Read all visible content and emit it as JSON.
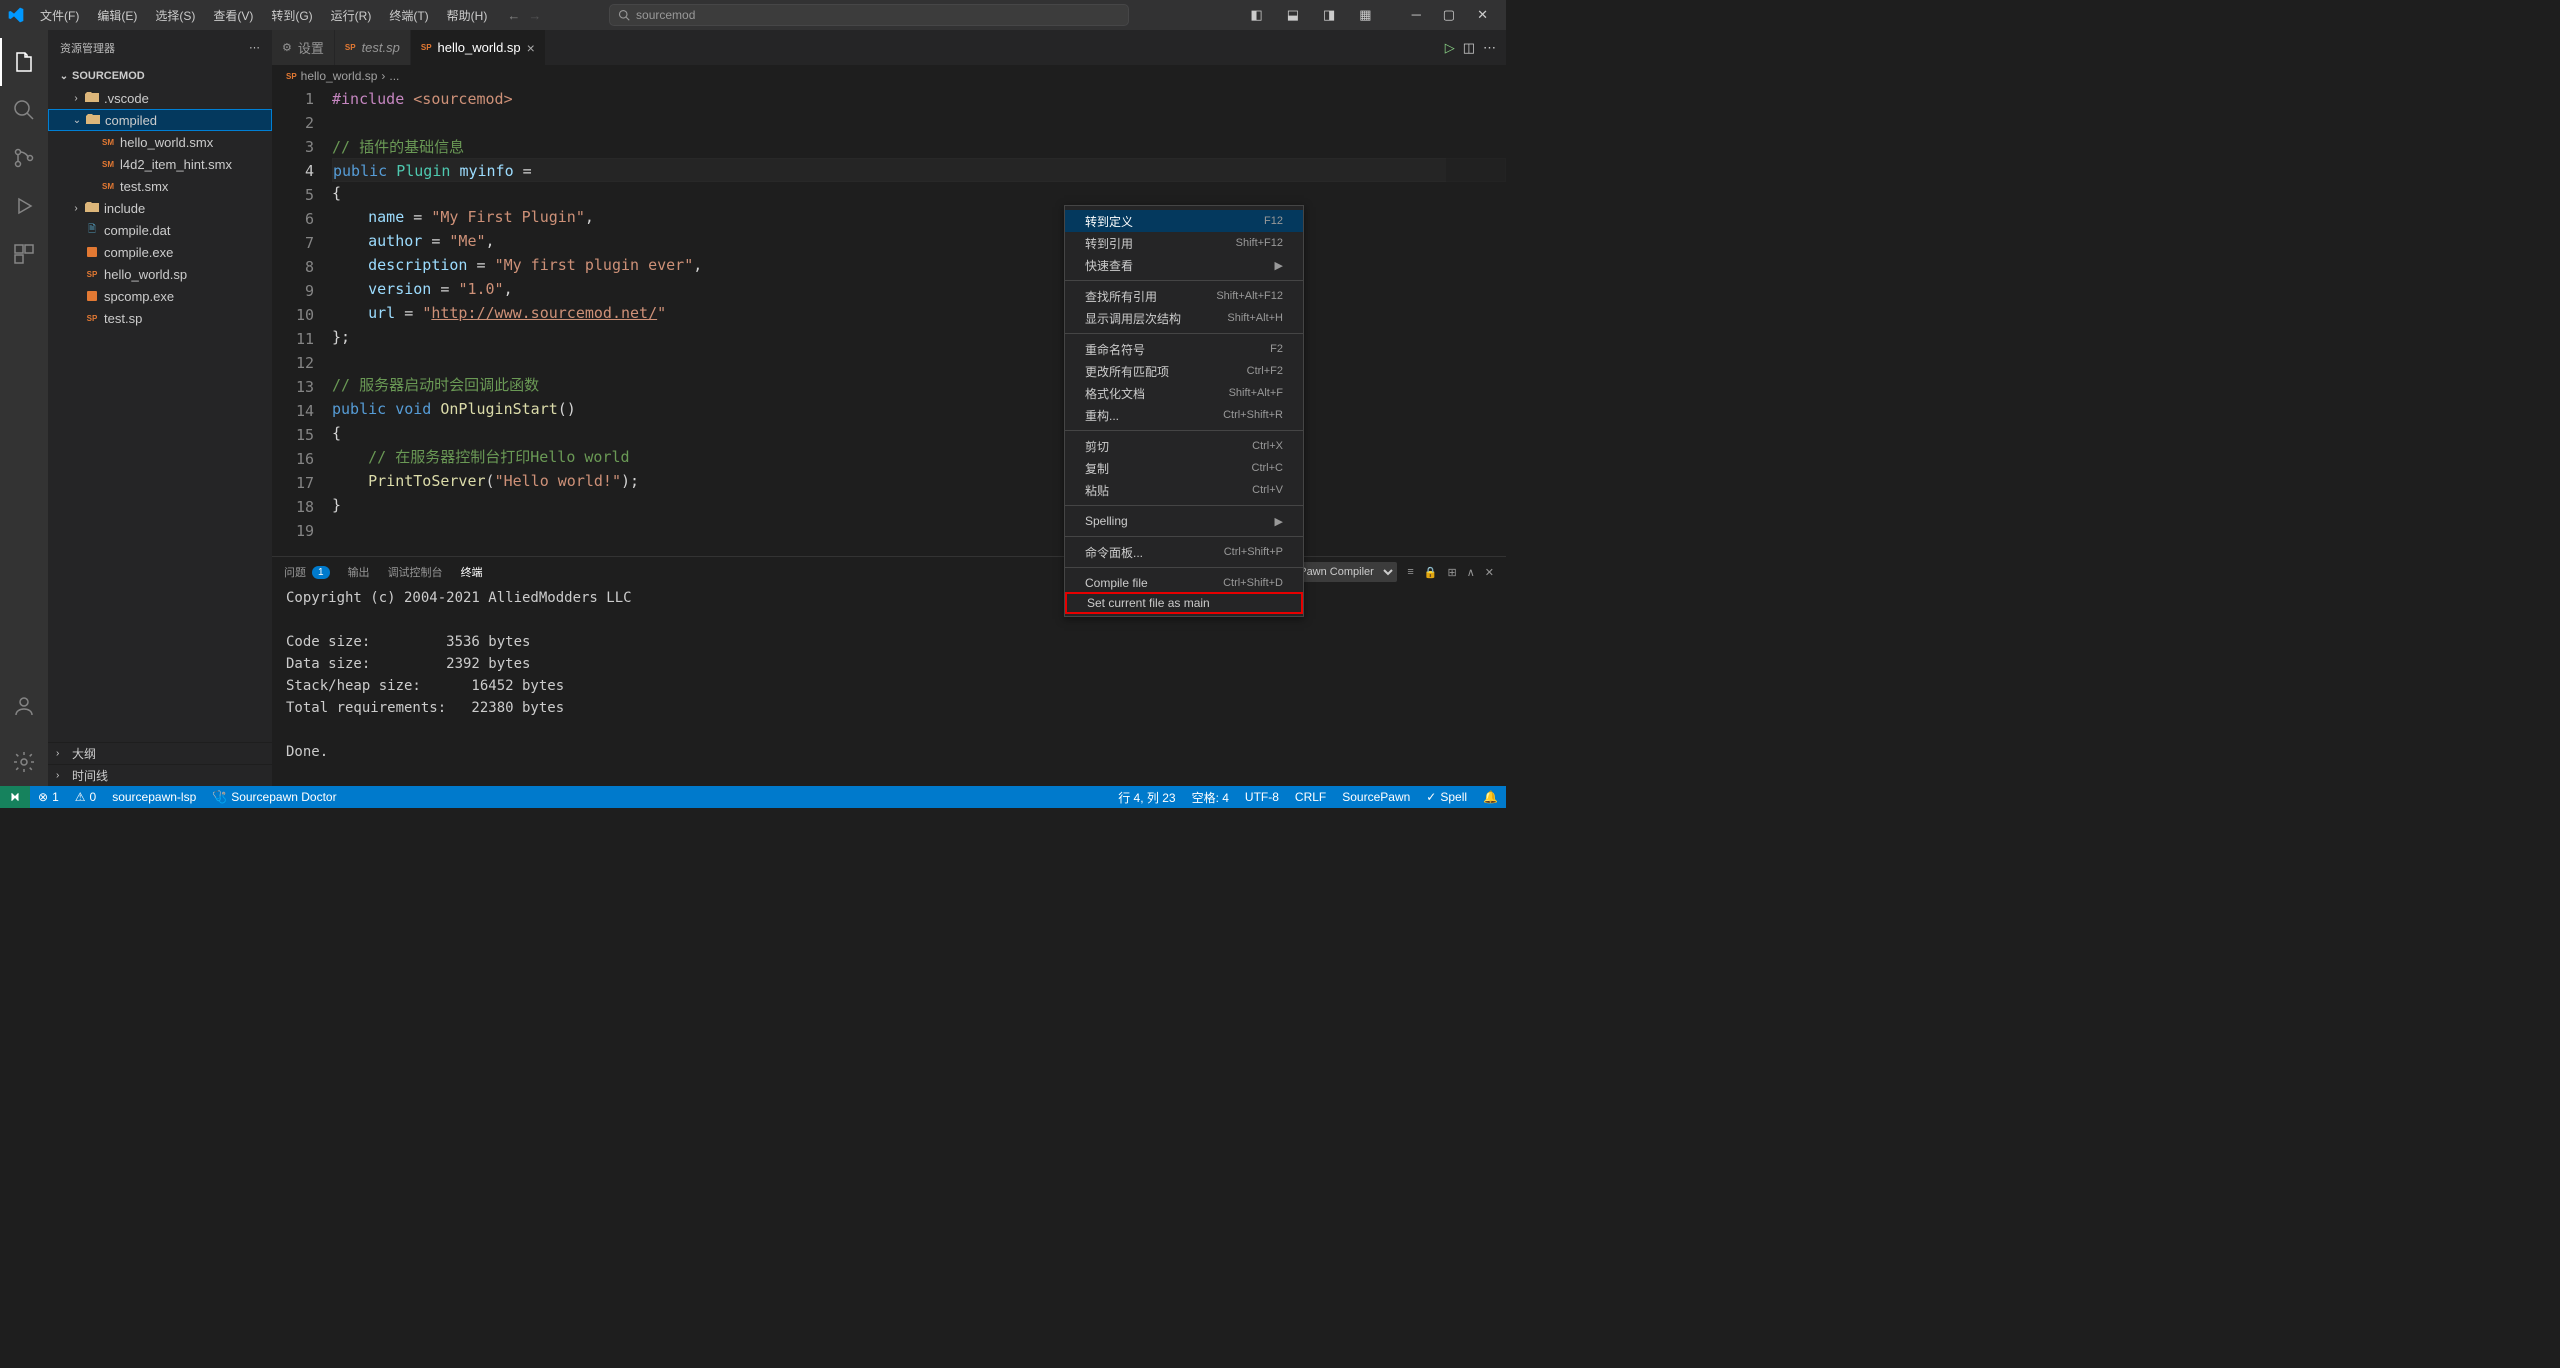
{
  "menubar": [
    "文件(F)",
    "编辑(E)",
    "选择(S)",
    "查看(V)",
    "转到(G)",
    "运行(R)",
    "终端(T)",
    "帮助(H)"
  ],
  "search_placeholder": "sourcemod",
  "sidebar": {
    "title": "资源管理器",
    "root": "SOURCEMOD",
    "tree": [
      {
        "t": "folder",
        "name": ".vscode",
        "ind": 1,
        "open": false
      },
      {
        "t": "folder",
        "name": "compiled",
        "ind": 1,
        "open": true,
        "selected": true
      },
      {
        "t": "file",
        "name": "hello_world.smx",
        "ind": 2,
        "icon": "sm"
      },
      {
        "t": "file",
        "name": "l4d2_item_hint.smx",
        "ind": 2,
        "icon": "sm"
      },
      {
        "t": "file",
        "name": "test.smx",
        "ind": 2,
        "icon": "sm"
      },
      {
        "t": "folder",
        "name": "include",
        "ind": 1,
        "open": false
      },
      {
        "t": "file",
        "name": "compile.dat",
        "ind": 1,
        "icon": "file-i"
      },
      {
        "t": "file",
        "name": "compile.exe",
        "ind": 1,
        "icon": "exe-i"
      },
      {
        "t": "file",
        "name": "hello_world.sp",
        "ind": 1,
        "icon": "sp"
      },
      {
        "t": "file",
        "name": "spcomp.exe",
        "ind": 1,
        "icon": "exe-i"
      },
      {
        "t": "file",
        "name": "test.sp",
        "ind": 1,
        "icon": "sp"
      }
    ],
    "footer": [
      "大纲",
      "时间线"
    ]
  },
  "tabs": [
    {
      "label": "设置",
      "icon": "gear",
      "active": false
    },
    {
      "label": "test.sp",
      "icon": "sp",
      "active": false,
      "italic": true
    },
    {
      "label": "hello_world.sp",
      "icon": "sp",
      "active": true,
      "close": true
    }
  ],
  "breadcrumb": [
    "hello_world.sp",
    "..."
  ],
  "code": {
    "lines": [
      [
        {
          "c": "tk-pre",
          "t": "#include"
        },
        {
          "c": "tk-p",
          "t": " "
        },
        {
          "c": "tk-inc",
          "t": "<sourcemod>"
        }
      ],
      [],
      [
        {
          "c": "tk-com",
          "t": "// 插件的基础信息"
        }
      ],
      [
        {
          "c": "tk-kw",
          "t": "public"
        },
        {
          "c": "tk-p",
          "t": " "
        },
        {
          "c": "tk-type",
          "t": "Plugin"
        },
        {
          "c": "tk-p",
          "t": " "
        },
        {
          "c": "tk-id",
          "t": "myinfo"
        },
        {
          "c": "tk-p",
          "t": " ="
        }
      ],
      [
        {
          "c": "tk-p",
          "t": "{"
        }
      ],
      [
        {
          "c": "tk-p",
          "t": "    "
        },
        {
          "c": "tk-id",
          "t": "name"
        },
        {
          "c": "tk-p",
          "t": " = "
        },
        {
          "c": "tk-str",
          "t": "\"My First Plugin\""
        },
        {
          "c": "tk-p",
          "t": ","
        }
      ],
      [
        {
          "c": "tk-p",
          "t": "    "
        },
        {
          "c": "tk-id",
          "t": "author"
        },
        {
          "c": "tk-p",
          "t": " = "
        },
        {
          "c": "tk-str",
          "t": "\"Me\""
        },
        {
          "c": "tk-p",
          "t": ","
        }
      ],
      [
        {
          "c": "tk-p",
          "t": "    "
        },
        {
          "c": "tk-id",
          "t": "description"
        },
        {
          "c": "tk-p",
          "t": " = "
        },
        {
          "c": "tk-str",
          "t": "\"My first plugin ever\""
        },
        {
          "c": "tk-p",
          "t": ","
        }
      ],
      [
        {
          "c": "tk-p",
          "t": "    "
        },
        {
          "c": "tk-id",
          "t": "version"
        },
        {
          "c": "tk-p",
          "t": " = "
        },
        {
          "c": "tk-str",
          "t": "\"1.0\""
        },
        {
          "c": "tk-p",
          "t": ","
        }
      ],
      [
        {
          "c": "tk-p",
          "t": "    "
        },
        {
          "c": "tk-id",
          "t": "url"
        },
        {
          "c": "tk-p",
          "t": " = "
        },
        {
          "c": "tk-str",
          "t": "\""
        },
        {
          "c": "tk-url",
          "t": "http://www.sourcemod.net/"
        },
        {
          "c": "tk-str",
          "t": "\""
        }
      ],
      [
        {
          "c": "tk-p",
          "t": "};"
        }
      ],
      [],
      [
        {
          "c": "tk-com",
          "t": "// 服务器启动时会回调此函数"
        }
      ],
      [
        {
          "c": "tk-kw",
          "t": "public"
        },
        {
          "c": "tk-p",
          "t": " "
        },
        {
          "c": "tk-kw",
          "t": "void"
        },
        {
          "c": "tk-p",
          "t": " "
        },
        {
          "c": "tk-fn",
          "t": "OnPluginStart"
        },
        {
          "c": "tk-p",
          "t": "()"
        }
      ],
      [
        {
          "c": "tk-p",
          "t": "{"
        }
      ],
      [
        {
          "c": "tk-p",
          "t": "    "
        },
        {
          "c": "tk-com",
          "t": "// 在服务器控制台打印Hello world"
        }
      ],
      [
        {
          "c": "tk-p",
          "t": "    "
        },
        {
          "c": "tk-fn",
          "t": "PrintToServer"
        },
        {
          "c": "tk-p",
          "t": "("
        },
        {
          "c": "tk-str",
          "t": "\"Hello world!\""
        },
        {
          "c": "tk-p",
          "t": ");"
        }
      ],
      [
        {
          "c": "tk-p",
          "t": "}"
        }
      ],
      []
    ],
    "current_line": 4
  },
  "panel": {
    "tabs": [
      {
        "label": "问题",
        "badge": "1"
      },
      {
        "label": "输出"
      },
      {
        "label": "调试控制台"
      },
      {
        "label": "终端",
        "active": true
      }
    ],
    "selector": "SourcePawn Compiler",
    "output": [
      "Copyright (c) 2004-2021 AlliedModders LLC",
      "",
      "Code size:         3536 bytes",
      "Data size:         2392 bytes",
      "Stack/heap size:      16452 bytes",
      "Total requirements:   22380 bytes",
      "",
      "Done."
    ]
  },
  "context_menu": [
    {
      "label": "转到定义",
      "short": "F12",
      "hover": true
    },
    {
      "label": "转到引用",
      "short": "Shift+F12"
    },
    {
      "label": "快速查看",
      "short": "▶"
    },
    {
      "sep": true
    },
    {
      "label": "查找所有引用",
      "short": "Shift+Alt+F12"
    },
    {
      "label": "显示调用层次结构",
      "short": "Shift+Alt+H"
    },
    {
      "sep": true
    },
    {
      "label": "重命名符号",
      "short": "F2"
    },
    {
      "label": "更改所有匹配项",
      "short": "Ctrl+F2"
    },
    {
      "label": "格式化文档",
      "short": "Shift+Alt+F"
    },
    {
      "label": "重构...",
      "short": "Ctrl+Shift+R"
    },
    {
      "sep": true
    },
    {
      "label": "剪切",
      "short": "Ctrl+X"
    },
    {
      "label": "复制",
      "short": "Ctrl+C"
    },
    {
      "label": "粘贴",
      "short": "Ctrl+V"
    },
    {
      "sep": true
    },
    {
      "label": "Spelling",
      "short": "▶"
    },
    {
      "sep": true
    },
    {
      "label": "命令面板...",
      "short": "Ctrl+Shift+P"
    },
    {
      "sep": true
    },
    {
      "label": "Compile file",
      "short": "Ctrl+Shift+D"
    },
    {
      "label": "Set current file as main",
      "highlight": true
    }
  ],
  "statusbar": {
    "left": [
      {
        "icon": "⊗",
        "text": "1"
      },
      {
        "icon": "⚠",
        "text": "0"
      },
      {
        "text": "sourcepawn-lsp"
      },
      {
        "icon": "🩺",
        "text": "Sourcepawn Doctor"
      }
    ],
    "right": [
      {
        "text": "行 4, 列 23"
      },
      {
        "text": "空格: 4"
      },
      {
        "text": "UTF-8"
      },
      {
        "text": "CRLF"
      },
      {
        "text": "SourcePawn"
      },
      {
        "icon": "✓",
        "text": "Spell"
      },
      {
        "icon": "🔔",
        "text": ""
      }
    ]
  }
}
